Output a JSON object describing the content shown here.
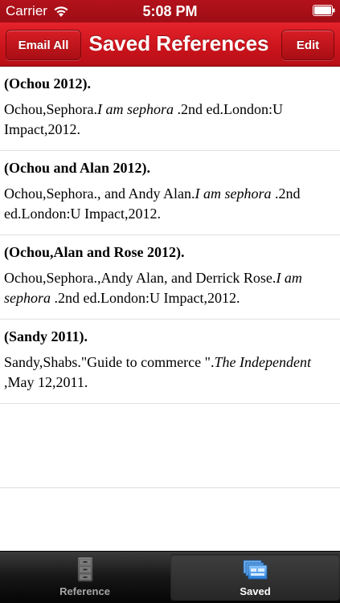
{
  "status_bar": {
    "carrier": "Carrier",
    "time": "5:08 PM"
  },
  "nav": {
    "title": "Saved References",
    "left_button": "Email All",
    "right_button": "Edit"
  },
  "references": [
    {
      "title": "(Ochou 2012).",
      "parts": [
        {
          "text": "Ochou,Sephora.",
          "italic": false
        },
        {
          "text": "I am sephora",
          "italic": true
        },
        {
          "text": " .2nd ed.London:U Impact,2012.",
          "italic": false
        }
      ]
    },
    {
      "title": "(Ochou and Alan 2012).",
      "parts": [
        {
          "text": "Ochou,Sephora., and Andy Alan.",
          "italic": false
        },
        {
          "text": "I am sephora",
          "italic": true
        },
        {
          "text": " .2nd ed.London:U Impact,2012.",
          "italic": false
        }
      ]
    },
    {
      "title": "(Ochou,Alan and Rose 2012).",
      "parts": [
        {
          "text": "Ochou,Sephora.,Andy Alan, and Derrick Rose.",
          "italic": false
        },
        {
          "text": "I am sephora",
          "italic": true
        },
        {
          "text": " .2nd ed.London:U Impact,2012.",
          "italic": false
        }
      ]
    },
    {
      "title": "(Sandy 2011).",
      "parts": [
        {
          "text": "Sandy,Shabs.\"Guide to commerce \".",
          "italic": false
        },
        {
          "text": "The Independent",
          "italic": true
        },
        {
          "text": " ,May 12,2011.",
          "italic": false
        }
      ]
    }
  ],
  "tabs": [
    {
      "label": "Reference",
      "icon": "file-cabinet-icon"
    },
    {
      "label": "Saved",
      "icon": "saved-files-icon"
    }
  ],
  "colors": {
    "brand_red": "#cc141c",
    "tab_bar": "#161616",
    "tab_selected_icon": "#3a8ee6"
  }
}
